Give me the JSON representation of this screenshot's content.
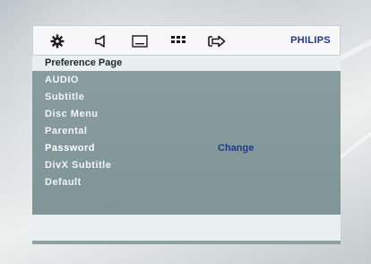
{
  "topbar": {
    "icons": [
      "gear-icon",
      "speaker-icon",
      "screen-icon",
      "grid-icon",
      "exit-arrow-icon"
    ],
    "brand": "PHILIPS"
  },
  "menu": {
    "title": "Preference Page",
    "items": [
      {
        "label": "AUDIO"
      },
      {
        "label": "Subtitle"
      },
      {
        "label": "Disc Menu"
      },
      {
        "label": "Parental"
      },
      {
        "label": "Password",
        "value": "Change",
        "selected": true
      },
      {
        "label": "DivX Subtitle"
      },
      {
        "label": "Default"
      }
    ]
  }
}
